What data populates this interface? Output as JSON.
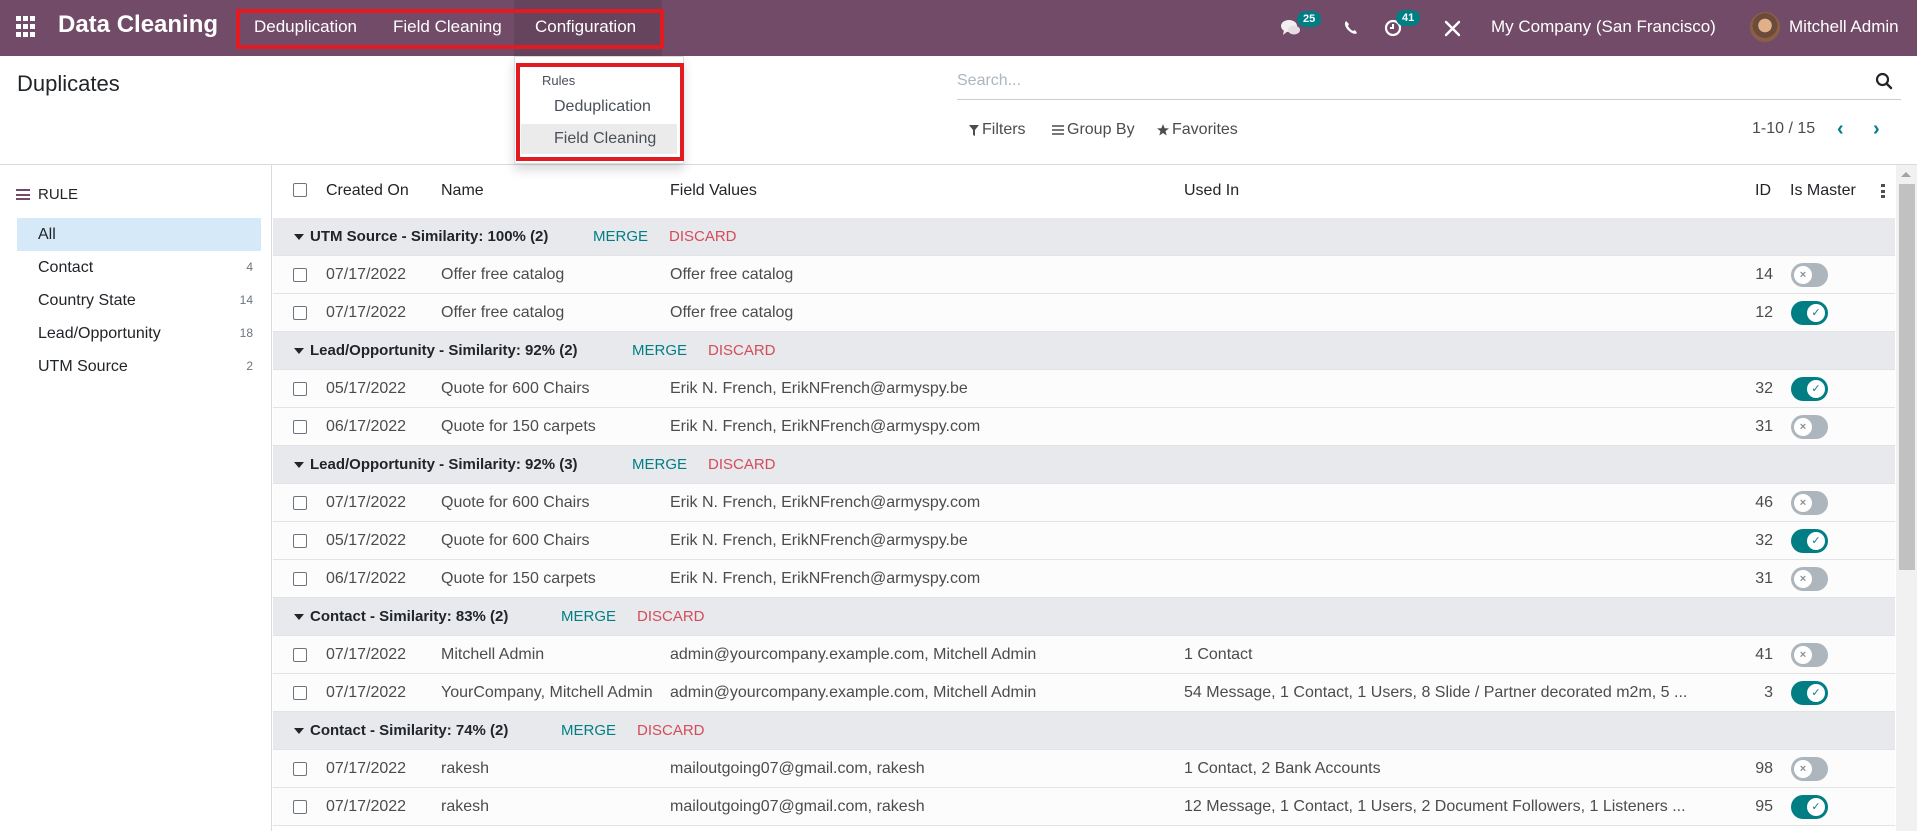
{
  "navbar": {
    "app_title": "Data Cleaning",
    "menus": [
      "Deduplication",
      "Field Cleaning",
      "Configuration"
    ],
    "messages_badge": "25",
    "activities_badge": "41",
    "company": "My Company (San Francisco)",
    "user": "Mitchell Admin",
    "brand_color": "#714B67",
    "accent_color": "#017e84",
    "highlight_color": "#e21b23"
  },
  "dropdown": {
    "header": "Rules",
    "items": [
      "Deduplication",
      "Field Cleaning"
    ],
    "hovered": "Field Cleaning"
  },
  "control_panel": {
    "title": "Duplicates",
    "search_placeholder": "Search...",
    "filters_label": "Filters",
    "groupby_label": "Group By",
    "favorites_label": "Favorites",
    "pager": "1-10 / 15"
  },
  "sidebar": {
    "heading": "RULE",
    "items": [
      {
        "label": "All",
        "count": "",
        "active": true
      },
      {
        "label": "Contact",
        "count": "4"
      },
      {
        "label": "Country State",
        "count": "14"
      },
      {
        "label": "Lead/Opportunity",
        "count": "18"
      },
      {
        "label": "UTM Source",
        "count": "2"
      }
    ]
  },
  "table": {
    "columns": [
      "Created On",
      "Name",
      "Field Values",
      "Used In",
      "ID",
      "Is Master"
    ],
    "merge_label": "MERGE",
    "discard_label": "DISCARD",
    "groups": [
      {
        "label": "UTM Source - Similarity: 100% (2)",
        "rows": [
          {
            "created": "07/17/2022",
            "name": "Offer free catalog",
            "values": "Offer free catalog",
            "used_in": "",
            "id": "14",
            "master": false
          },
          {
            "created": "07/17/2022",
            "name": "Offer free catalog",
            "values": "Offer free catalog",
            "used_in": "",
            "id": "12",
            "master": true
          }
        ]
      },
      {
        "label": "Lead/Opportunity - Similarity: 92% (2)",
        "rows": [
          {
            "created": "05/17/2022",
            "name": "Quote for 600 Chairs",
            "values": "Erik N. French, ErikNFrench@armyspy.be",
            "used_in": "",
            "id": "32",
            "master": true
          },
          {
            "created": "06/17/2022",
            "name": "Quote for 150 carpets",
            "values": "Erik N. French, ErikNFrench@armyspy.com",
            "used_in": "",
            "id": "31",
            "master": false
          }
        ]
      },
      {
        "label": "Lead/Opportunity - Similarity: 92% (3)",
        "rows": [
          {
            "created": "07/17/2022",
            "name": "Quote for 600 Chairs",
            "values": "Erik N. French, ErikNFrench@armyspy.com",
            "used_in": "",
            "id": "46",
            "master": false
          },
          {
            "created": "05/17/2022",
            "name": "Quote for 600 Chairs",
            "values": "Erik N. French, ErikNFrench@armyspy.be",
            "used_in": "",
            "id": "32",
            "master": true
          },
          {
            "created": "06/17/2022",
            "name": "Quote for 150 carpets",
            "values": "Erik N. French, ErikNFrench@armyspy.com",
            "used_in": "",
            "id": "31",
            "master": false
          }
        ]
      },
      {
        "label": "Contact - Similarity: 83% (2)",
        "rows": [
          {
            "created": "07/17/2022",
            "name": "Mitchell Admin",
            "values": "admin@yourcompany.example.com, Mitchell Admin",
            "used_in": "1 Contact",
            "id": "41",
            "master": false
          },
          {
            "created": "07/17/2022",
            "name": "YourCompany, Mitchell Admin",
            "values": "admin@yourcompany.example.com, Mitchell Admin",
            "used_in": "54 Message, 1 Contact, 1 Users, 8 Slide / Partner decorated m2m, 5 ...",
            "id": "3",
            "master": true
          }
        ]
      },
      {
        "label": "Contact - Similarity: 74% (2)",
        "rows": [
          {
            "created": "07/17/2022",
            "name": "rakesh",
            "values": "mailoutgoing07@gmail.com, rakesh",
            "used_in": "1 Contact, 2 Bank Accounts",
            "id": "98",
            "master": false
          },
          {
            "created": "07/17/2022",
            "name": "rakesh",
            "values": "mailoutgoing07@gmail.com, rakesh",
            "used_in": "12 Message, 1 Contact, 1 Users, 2 Document Followers, 1 Listeners ...",
            "id": "95",
            "master": true
          }
        ]
      }
    ]
  }
}
